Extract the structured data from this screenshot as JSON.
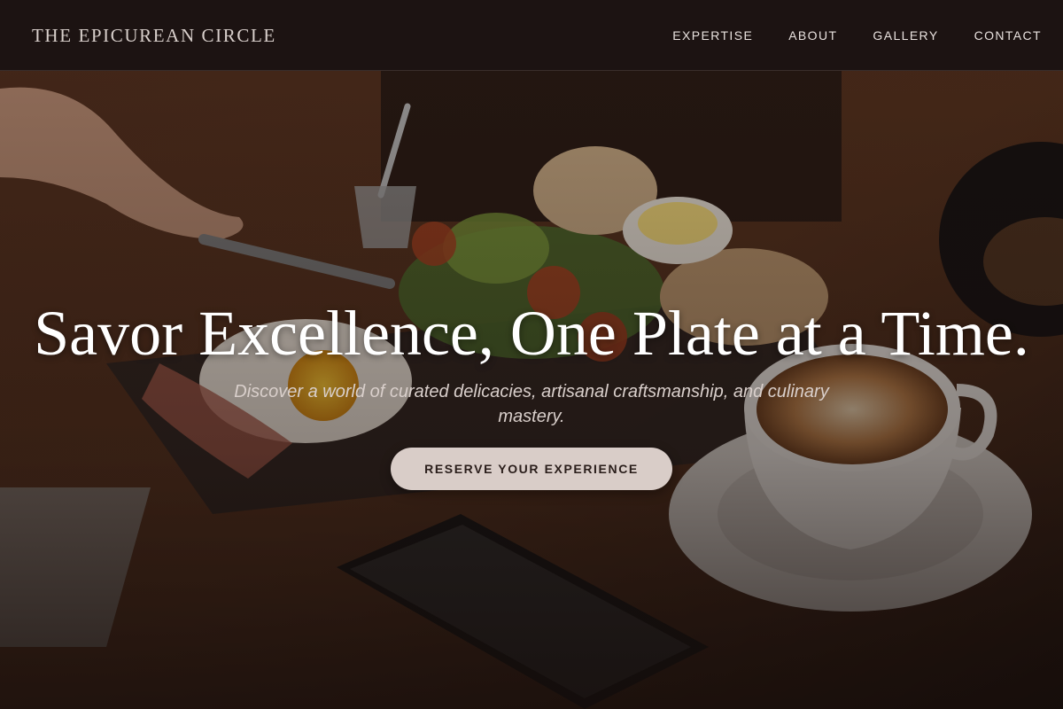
{
  "header": {
    "brand": "THE EPICUREAN CIRCLE",
    "nav": [
      {
        "label": "EXPERTISE"
      },
      {
        "label": "ABOUT"
      },
      {
        "label": "GALLERY"
      },
      {
        "label": "CONTACT"
      }
    ]
  },
  "hero": {
    "title": "Savor Excellence, One Plate at a Time.",
    "subtitle": "Discover a world of curated delicacies, artisanal craftsmanship, and culinary mastery.",
    "cta_label": "RESERVE YOUR EXPERIENCE",
    "background_image": "breakfast-table-photo"
  },
  "colors": {
    "nav_bg": "#1c1312",
    "brand_text": "#d8cfcb",
    "cta_bg": "#d9cdc8",
    "cta_text": "#2a1e1b"
  }
}
